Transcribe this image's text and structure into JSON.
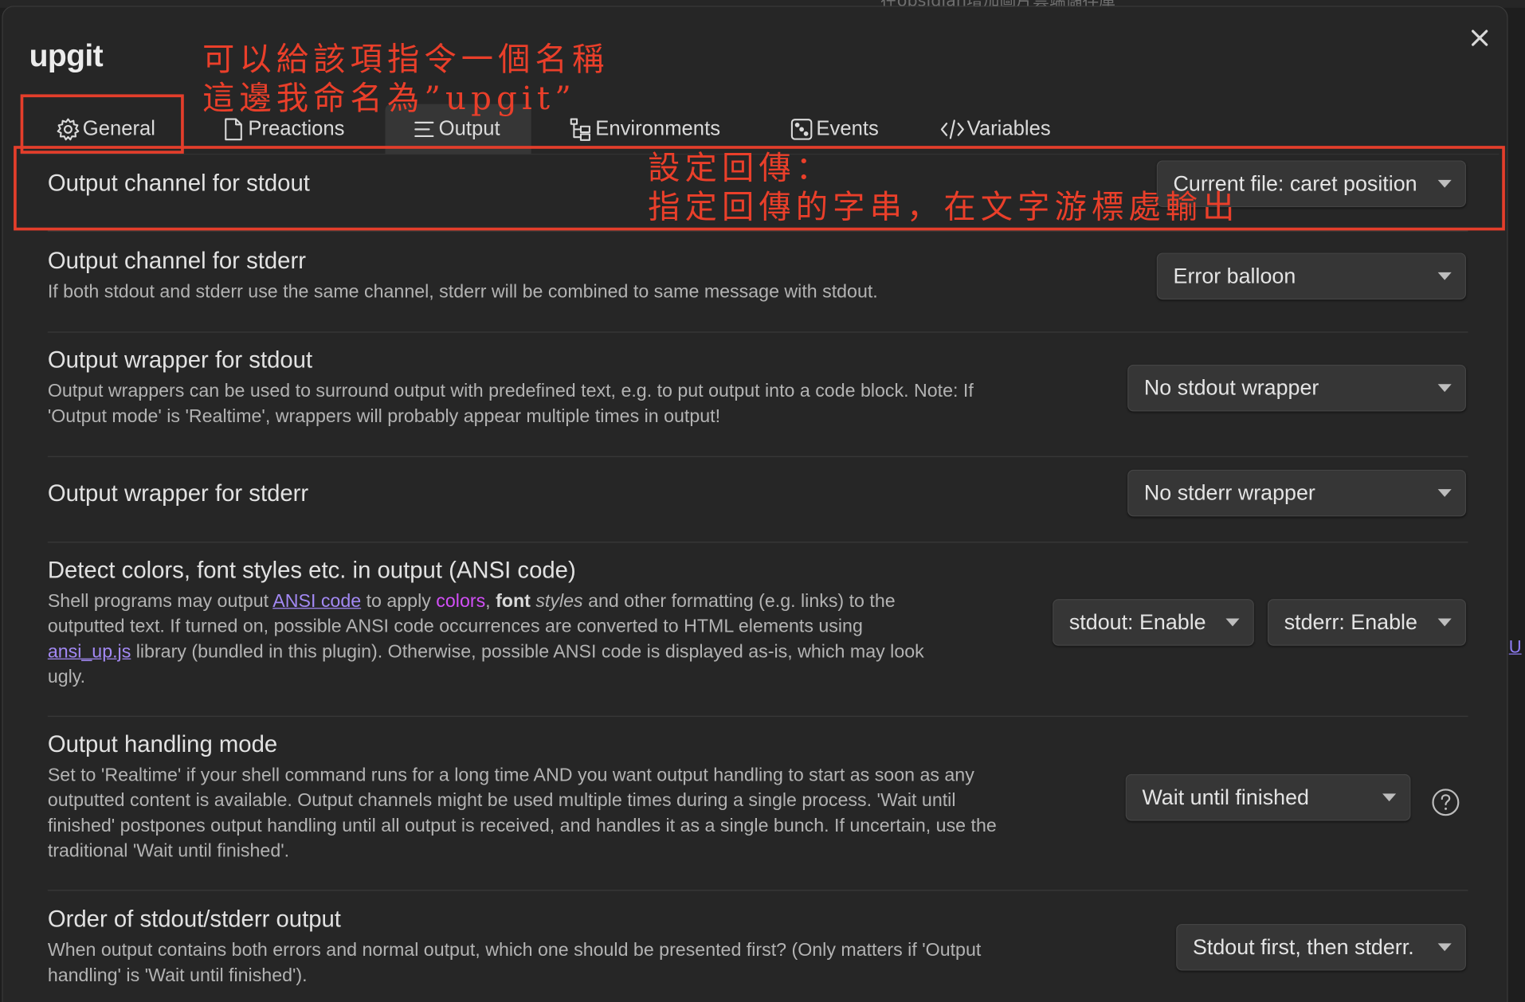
{
  "background": {
    "top_title": "在obsidian增加圖片雲端儲存庫",
    "right_link": "U"
  },
  "modal": {
    "title": "upgit",
    "close_icon": "close-icon"
  },
  "tabs": [
    {
      "label": "General",
      "icon": "gear-icon"
    },
    {
      "label": "Preactions",
      "icon": "file-icon"
    },
    {
      "label": "Output",
      "icon": "lines-icon"
    },
    {
      "label": "Environments",
      "icon": "tree-icon"
    },
    {
      "label": "Events",
      "icon": "dice-icon"
    },
    {
      "label": "Variables",
      "icon": "code-icon"
    }
  ],
  "active_tab": "Output",
  "settings": {
    "stdout_channel": {
      "name": "Output channel for stdout",
      "value": "Current file: caret position"
    },
    "stderr_channel": {
      "name": "Output channel for stderr",
      "desc": "If both stdout and stderr use the same channel, stderr will be combined to same message with stdout.",
      "value": "Error balloon"
    },
    "stdout_wrapper": {
      "name": "Output wrapper for stdout",
      "desc_line1": "Output wrappers can be used to surround output with predefined text, e.g. to put output into a code block. Note: If",
      "desc_line2": "'Output mode' is 'Realtime', wrappers will probably appear multiple times in output!",
      "value": "No stdout wrapper"
    },
    "stderr_wrapper": {
      "name": "Output wrapper for stderr",
      "value": "No stderr wrapper"
    },
    "ansi": {
      "name": "Detect colors, font styles etc. in output (ANSI code)",
      "desc_a": "Shell programs may output ",
      "link_ansi": "ANSI code",
      "desc_b": " to apply ",
      "colors_word": "colors",
      "desc_c": ", ",
      "font_word": "font",
      "styles_word": "styles",
      "desc_d": " and other formatting (e.g. links) to the",
      "desc_line2": "outputted text. If turned on, possible ANSI code occurrences are converted to HTML elements using",
      "link_ansi_up": "ansi_up.js",
      "desc_e": " library (bundled in this plugin). Otherwise, possible ANSI code is displayed as-is, which may look",
      "desc_line4": "ugly.",
      "stdout_value": "stdout: Enable",
      "stderr_value": "stderr: Enable"
    },
    "handling_mode": {
      "name": "Output handling mode",
      "desc_line1": "Set to 'Realtime' if your shell command runs for a long time AND you want output handling to start as soon as any",
      "desc_line2": "outputted content is available. Output channels might be used multiple times during a single process. 'Wait until",
      "desc_line3": "finished' postpones output handling until all output is received, and handles it as a single bunch. If uncertain, use the",
      "desc_line4": "traditional 'Wait until finished'.",
      "value": "Wait until finished",
      "help_icon": "help-circle-icon"
    },
    "order": {
      "name": "Order of stdout/stderr output",
      "desc_line1": "When output contains both errors and normal output, which one should be presented first? (Only matters if 'Output",
      "desc_line2": "handling' is 'Wait until finished').",
      "value": "Stdout first, then stderr."
    }
  },
  "annotations": {
    "name_note_line1": "可以給該項指令一個名稱",
    "name_note_line2": "這邊我命名為”upgit”",
    "return_note_line1": "設定回傳：",
    "return_note_line2": "指定回傳的字串，在文字游標處輸出",
    "color": "#e43e2b"
  }
}
